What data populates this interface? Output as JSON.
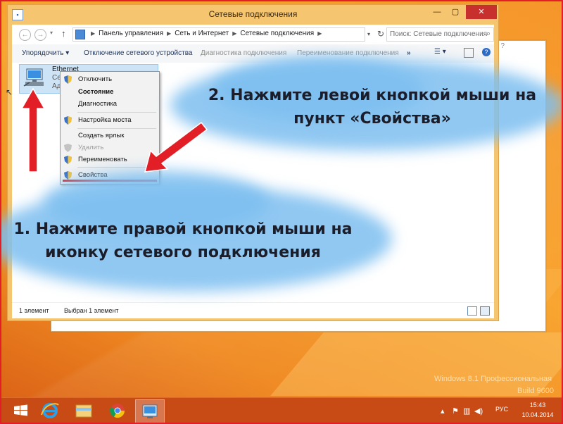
{
  "window": {
    "title": "Сетевые подключения",
    "controls": {
      "minimize": "—",
      "maximize": "▢",
      "close": "✕"
    }
  },
  "address": {
    "breadcrumb": [
      "Панель управления",
      "Сеть и Интернет",
      "Сетевые подключения"
    ],
    "search_placeholder": "Поиск: Сетевые подключения"
  },
  "commands": {
    "organize": "Упорядочить ▾",
    "disconnect": "Отключение сетевого устройства",
    "diagnose": "Диагностика подключения",
    "rename": "Переименование подключения",
    "more": "»",
    "help": "?"
  },
  "item": {
    "name": "Ethernet",
    "line2": "Сеть",
    "line3": "Ада"
  },
  "context_menu": {
    "items": [
      {
        "label": "Отключить",
        "shield": true,
        "bold": false,
        "disabled": false
      },
      {
        "label": "Состояние",
        "shield": false,
        "bold": true,
        "disabled": false
      },
      {
        "label": "Диагностика",
        "shield": false,
        "bold": false,
        "disabled": false
      },
      {
        "label": "Настройка моста",
        "shield": true,
        "bold": false,
        "disabled": false
      },
      {
        "label": "Создать ярлык",
        "shield": false,
        "bold": false,
        "disabled": false
      },
      {
        "label": "Удалить",
        "shield": true,
        "bold": false,
        "disabled": true
      },
      {
        "label": "Переименовать",
        "shield": true,
        "bold": false,
        "disabled": false
      },
      {
        "label": "Свойства",
        "shield": true,
        "bold": false,
        "disabled": false
      }
    ]
  },
  "status": {
    "count": "1 элемент",
    "selected": "Выбран 1 элемент"
  },
  "instructions": {
    "step2_line1": "2. Нажмите левой кнопкой мыши на",
    "step2_line2": "пункт «Свойства»",
    "step1_line1": "1. Нажмите правой кнопкой мыши на",
    "step1_line2": "иконку сетевого подключения"
  },
  "watermark": {
    "edition": "Windows 8.1 Профессиональная",
    "build": "Build 9600"
  },
  "taskbar": {
    "lang": "РУС",
    "time": "15:43",
    "date": "10.04.2014"
  },
  "colors": {
    "accent_red": "#e21e26",
    "window_frame": "#f6c56f",
    "cloud_blue": "#7dbef0",
    "taskbar": "#c84a14"
  }
}
